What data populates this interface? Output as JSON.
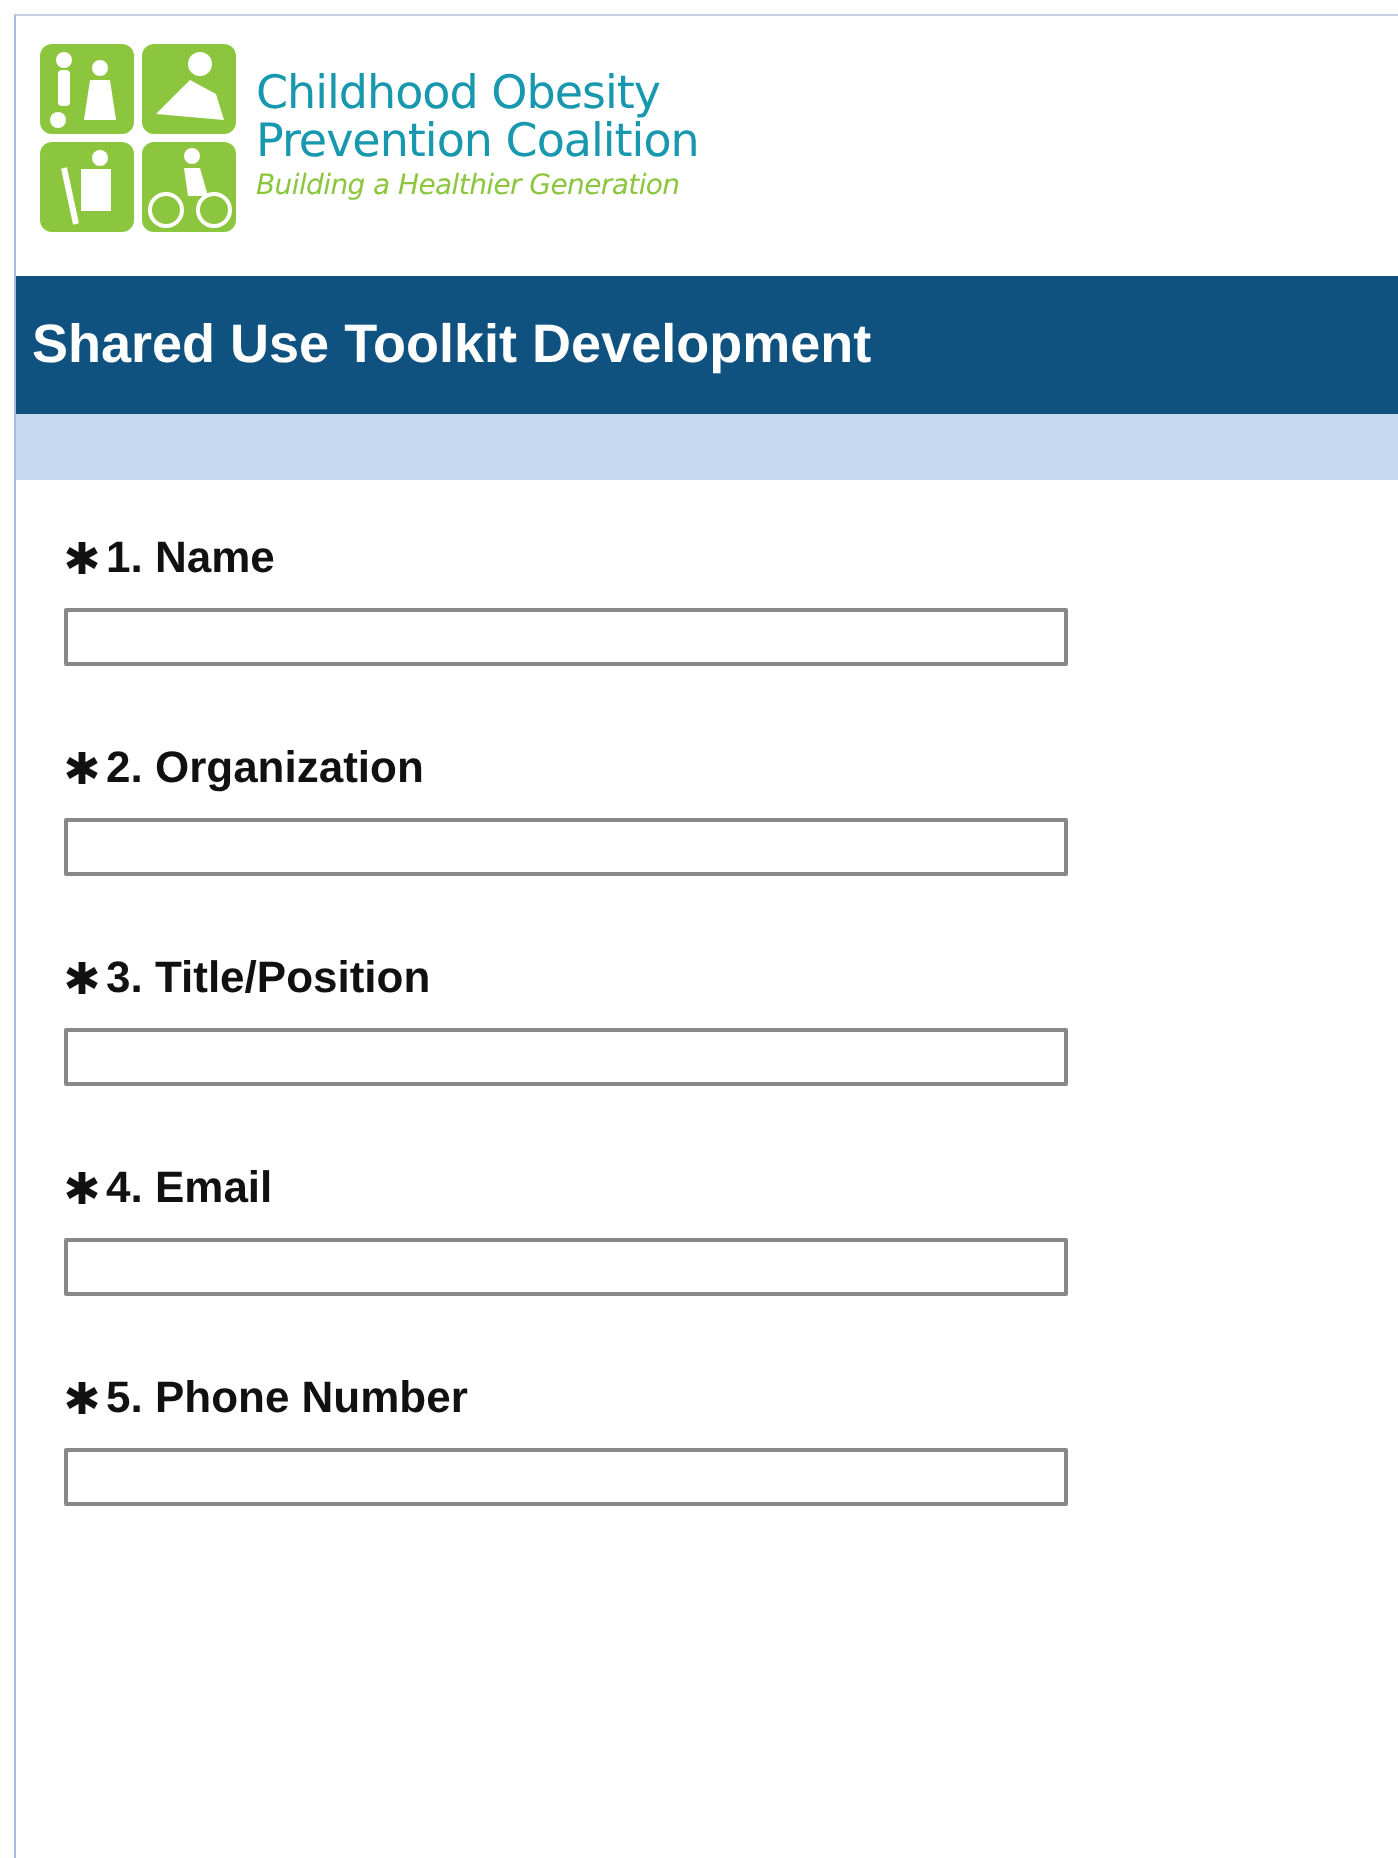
{
  "logo": {
    "name_lines": [
      "Childhood Obesity",
      "Prevention Coalition"
    ],
    "tagline": "Building a Healthier Generation"
  },
  "header": {
    "title": "Shared Use Toolkit Development"
  },
  "questions": [
    {
      "label": "1. Name",
      "required": true
    },
    {
      "label": "2. Organization",
      "required": true
    },
    {
      "label": "3. Title/Position",
      "required": true
    },
    {
      "label": "4. Email",
      "required": true
    },
    {
      "label": "5. Phone Number",
      "required": true
    }
  ]
}
